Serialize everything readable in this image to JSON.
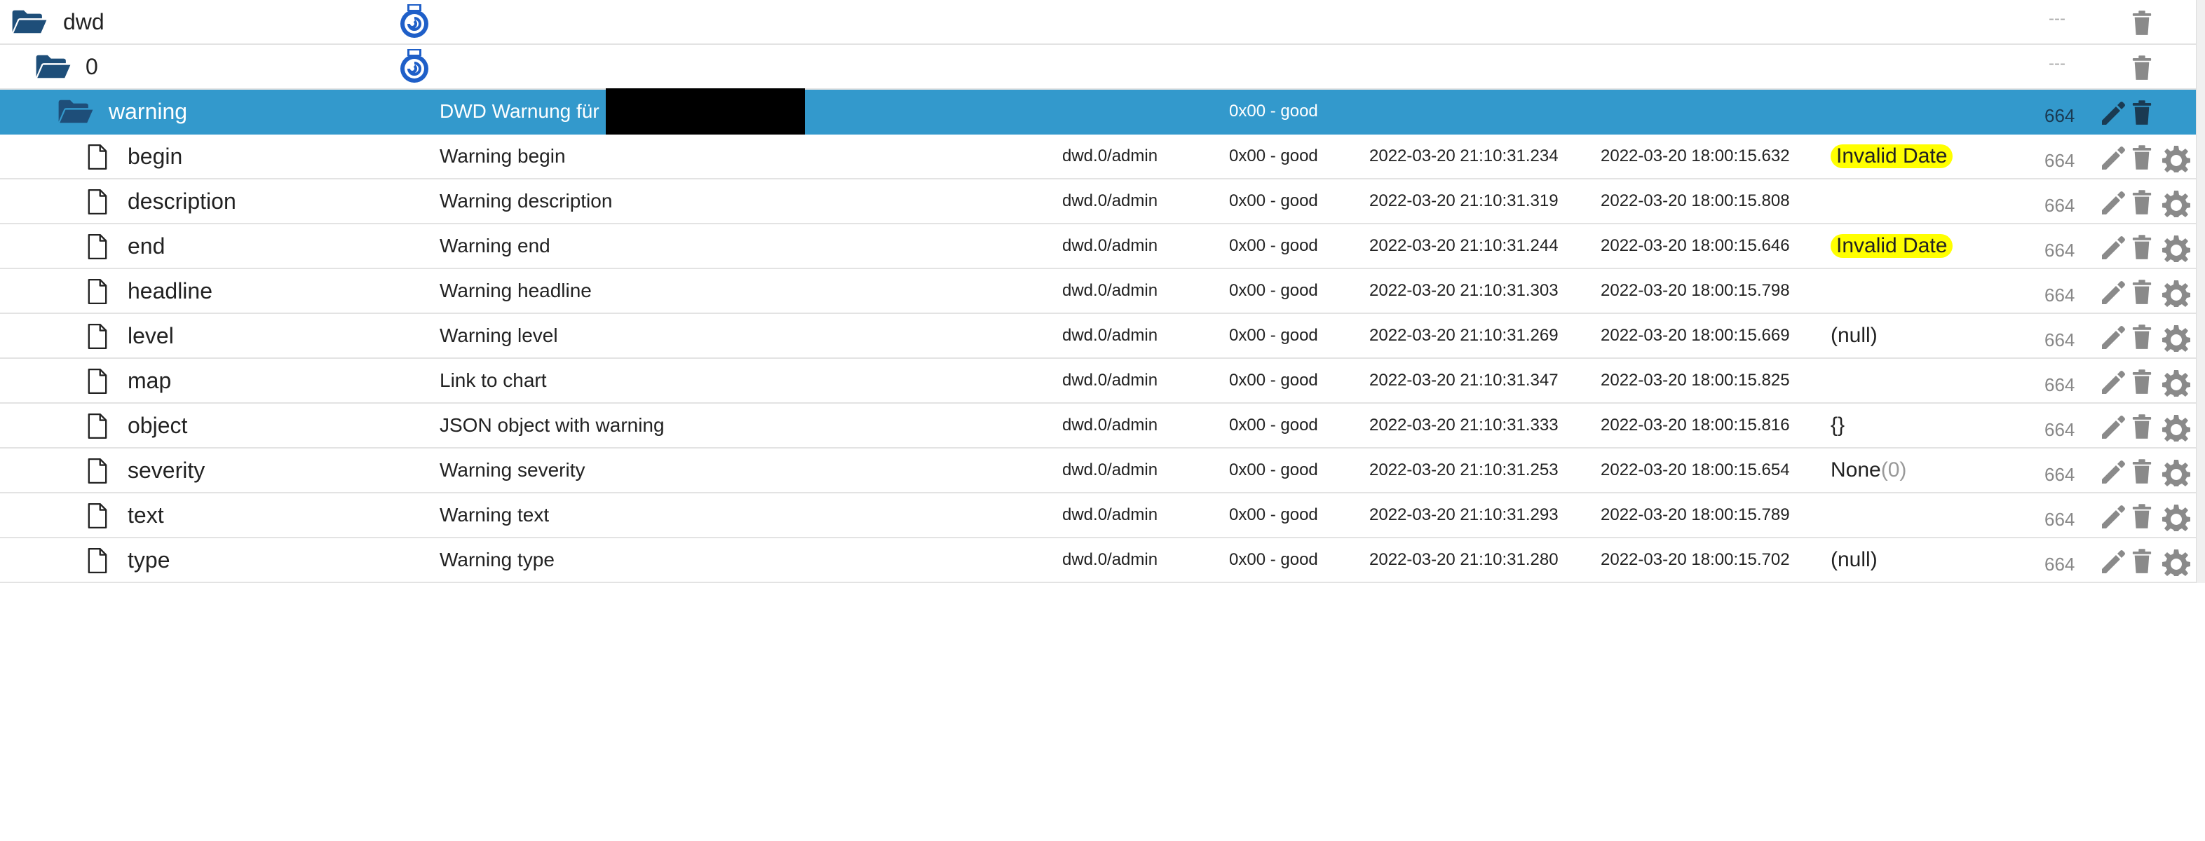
{
  "colors": {
    "selected_bg": "#3399cc",
    "highlight": "#ffff00",
    "folder": "#1e4e79",
    "icon_gray": "#8a8a8a"
  },
  "tree": {
    "root": {
      "name": "dwd",
      "icon": "folder-open-icon",
      "adapter_icon": "dwd-adapter-icon",
      "access": "---"
    },
    "instance": {
      "name": "0",
      "icon": "folder-open-icon",
      "adapter_icon": "dwd-adapter-icon",
      "access": "---"
    },
    "warning": {
      "name": "warning",
      "description": "DWD Warnung für",
      "status": "0x00 - good",
      "access": "664"
    },
    "states": [
      {
        "name": "begin",
        "description": "Warning begin",
        "role": "dwd.0/admin",
        "status": "0x00 - good",
        "timestamp": "2022-03-20 21:10:31.234",
        "last_change": "2022-03-20 18:00:15.632",
        "value": "Invalid Date",
        "access": "664"
      },
      {
        "name": "description",
        "description": "Warning description",
        "role": "dwd.0/admin",
        "status": "0x00 - good",
        "timestamp": "2022-03-20 21:10:31.319",
        "last_change": "2022-03-20 18:00:15.808",
        "value": "",
        "access": "664"
      },
      {
        "name": "end",
        "description": "Warning end",
        "role": "dwd.0/admin",
        "status": "0x00 - good",
        "timestamp": "2022-03-20 21:10:31.244",
        "last_change": "2022-03-20 18:00:15.646",
        "value": "Invalid Date",
        "access": "664"
      },
      {
        "name": "headline",
        "description": "Warning headline",
        "role": "dwd.0/admin",
        "status": "0x00 - good",
        "timestamp": "2022-03-20 21:10:31.303",
        "last_change": "2022-03-20 18:00:15.798",
        "value": "",
        "access": "664"
      },
      {
        "name": "level",
        "description": "Warning level",
        "role": "dwd.0/admin",
        "status": "0x00 - good",
        "timestamp": "2022-03-20 21:10:31.269",
        "last_change": "2022-03-20 18:00:15.669",
        "value": "(null)",
        "access": "664"
      },
      {
        "name": "map",
        "description": "Link to chart",
        "role": "dwd.0/admin",
        "status": "0x00 - good",
        "timestamp": "2022-03-20 21:10:31.347",
        "last_change": "2022-03-20 18:00:15.825",
        "value": "",
        "access": "664"
      },
      {
        "name": "object",
        "description": "JSON object with warning",
        "role": "dwd.0/admin",
        "status": "0x00 - good",
        "timestamp": "2022-03-20 21:10:31.333",
        "last_change": "2022-03-20 18:00:15.816",
        "value": "{}",
        "access": "664"
      },
      {
        "name": "severity",
        "description": "Warning severity",
        "role": "dwd.0/admin",
        "status": "0x00 - good",
        "timestamp": "2022-03-20 21:10:31.253",
        "last_change": "2022-03-20 18:00:15.654",
        "value": "None",
        "value_suffix": "(0)",
        "access": "664"
      },
      {
        "name": "text",
        "description": "Warning text",
        "role": "dwd.0/admin",
        "status": "0x00 - good",
        "timestamp": "2022-03-20 21:10:31.293",
        "last_change": "2022-03-20 18:00:15.789",
        "value": "",
        "access": "664"
      },
      {
        "name": "type",
        "description": "Warning type",
        "role": "dwd.0/admin",
        "status": "0x00 - good",
        "timestamp": "2022-03-20 21:10:31.280",
        "last_change": "2022-03-20 18:00:15.702",
        "value": "(null)",
        "access": "664"
      }
    ]
  }
}
